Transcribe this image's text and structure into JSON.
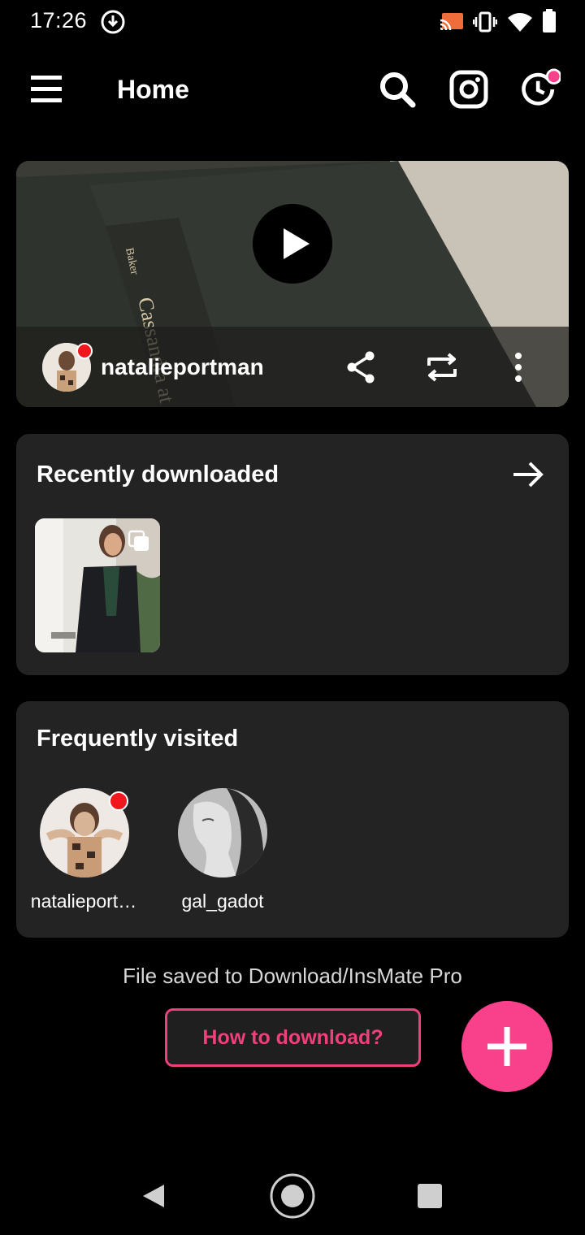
{
  "status_bar": {
    "time": "17:26",
    "icons": [
      "download-indicator-icon",
      "cast-icon",
      "vibrate-icon",
      "wifi-icon",
      "battery-icon"
    ]
  },
  "app_bar": {
    "title": "Home",
    "icons": [
      "menu-icon",
      "search-icon",
      "instagram-icon",
      "history-icon"
    ],
    "history_badge_color": "#f9408a"
  },
  "featured_post": {
    "username": "natalieportman",
    "actions": [
      "share-icon",
      "repost-icon",
      "more-options-icon"
    ],
    "book_text": "Cassandra at",
    "book_author": "Baker"
  },
  "recently_downloaded": {
    "title": "Recently downloaded",
    "arrow_icon": "arrow-right-icon",
    "items": [
      {
        "type": "carousel",
        "icon": "multiple-images-icon"
      }
    ]
  },
  "frequently_visited": {
    "title": "Frequently visited",
    "users": [
      {
        "name": "natalieport…",
        "has_live_dot": true
      },
      {
        "name": "gal_gadot",
        "has_live_dot": false
      }
    ]
  },
  "footer": {
    "saved_note": "File saved to Download/InsMate Pro",
    "how_to_label": "How to download?",
    "fab_icon": "plus-icon"
  },
  "colors": {
    "accent": "#f9408a",
    "card_bg": "#232323",
    "background": "#000000"
  },
  "nav_bar": {
    "icons": [
      "back-icon",
      "home-icon",
      "recents-icon"
    ]
  }
}
